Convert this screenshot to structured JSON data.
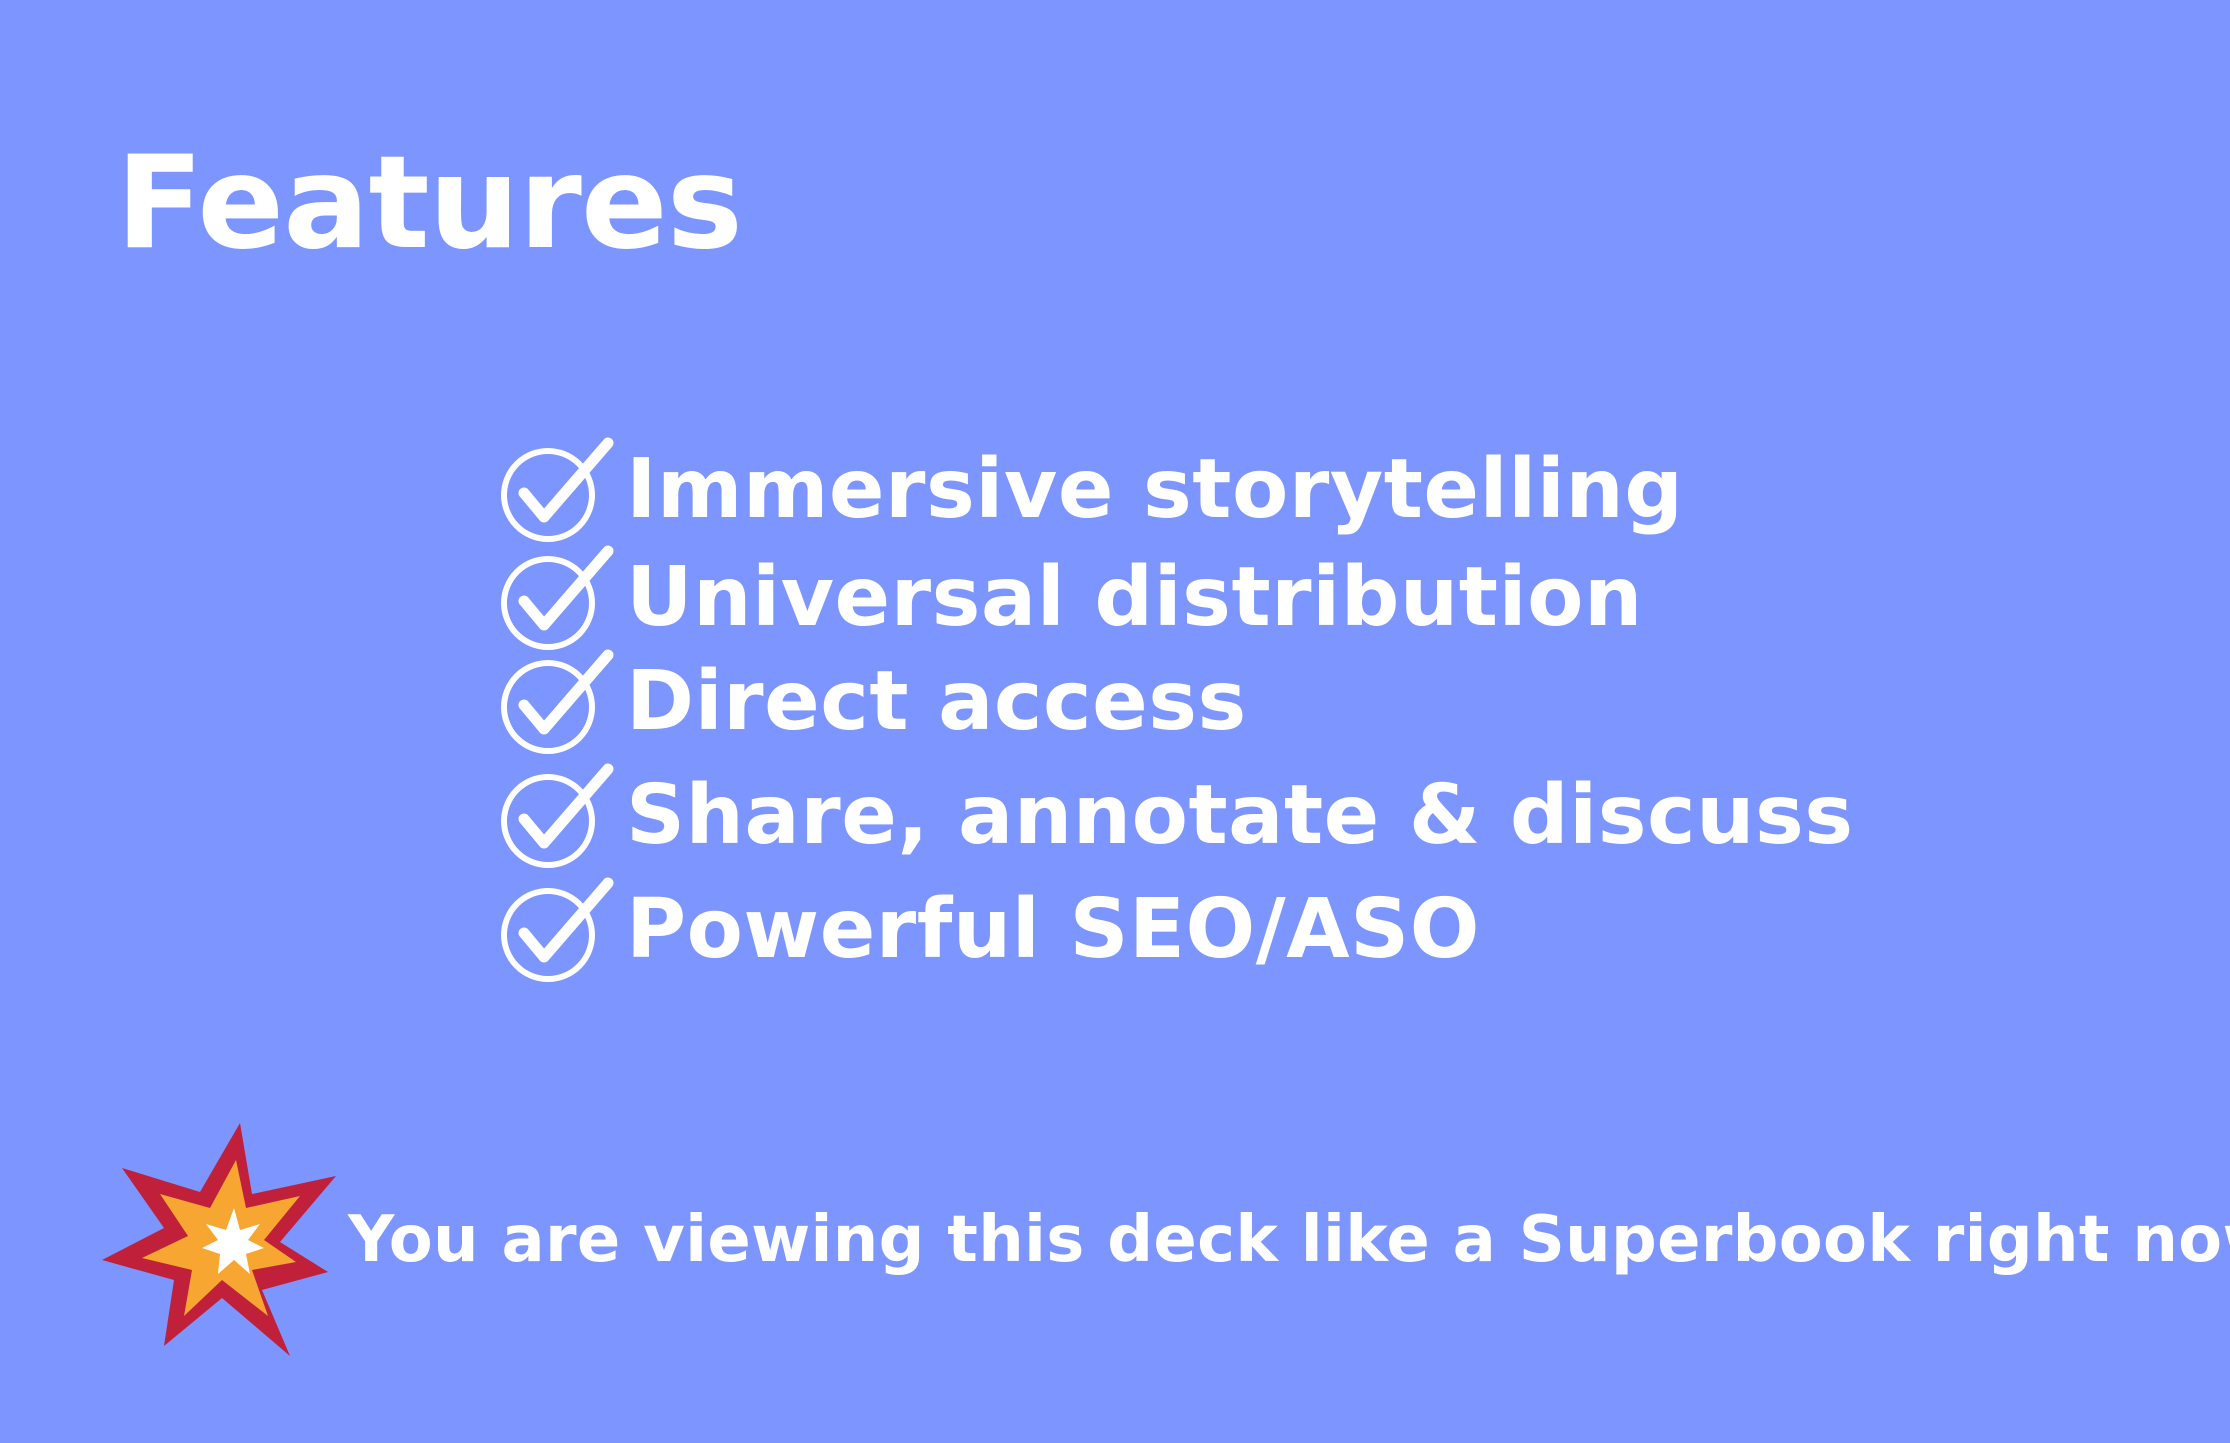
{
  "slide": {
    "title": "Features",
    "background_color": "#7d95fe",
    "text_color": "#ffffff",
    "features": [
      {
        "icon": "check-circle-icon",
        "label": "Immersive storytelling"
      },
      {
        "icon": "check-circle-icon",
        "label": "Universal distribution"
      },
      {
        "icon": "check-circle-icon",
        "label": "Direct access"
      },
      {
        "icon": "check-circle-icon",
        "label": "Share, annotate & discuss"
      },
      {
        "icon": "check-circle-icon",
        "label": "Powerful SEO/ASO"
      }
    ],
    "footer": {
      "icon": "collision-burst-icon",
      "text": "You are viewing this deck like a Superbook right now!",
      "icon_colors": {
        "outer": "#c0203a",
        "middle": "#f6a631",
        "inner": "#ffffff"
      }
    }
  }
}
